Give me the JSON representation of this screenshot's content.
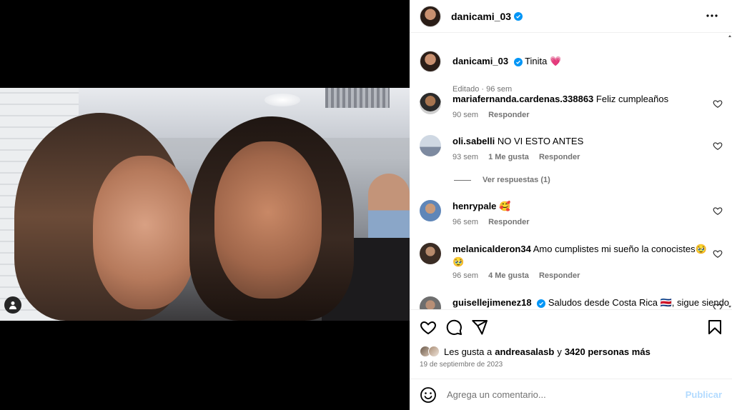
{
  "post": {
    "author": "danicami_03",
    "caption": "Tinita",
    "caption_emoji": "💗",
    "edited_label": "Editado",
    "age": "96 sem"
  },
  "comments": [
    {
      "user": "mariafernanda.cardenas.338863",
      "text": "Feliz cumpleaños",
      "age": "90 sem",
      "likes": "",
      "reply": "Responder"
    },
    {
      "user": "oli.sabelli",
      "text": "NO VI ESTO ANTES",
      "age": "93 sem",
      "likes": "1 Me gusta",
      "reply": "Responder",
      "view_replies": "Ver respuestas (1)"
    },
    {
      "user": "henrypale",
      "text": "🥰",
      "age": "96 sem",
      "likes": "",
      "reply": "Responder"
    },
    {
      "user": "melanicalderon34",
      "text": "Amo cumplistes mi sueño la conocistes🥹",
      "text2": "🥹",
      "age": "96 sem",
      "likes": "4 Me gusta",
      "reply": "Responder"
    },
    {
      "user": "guisellejimenez18",
      "text": "Saludos desde Costa Rica 🇨🇷, sigue siendo"
    }
  ],
  "likes": {
    "prefix": "Les gusta a",
    "user": "andreasalasb",
    "conj": "y",
    "others": "3420 personas más"
  },
  "date": "19 de septiembre de 2023",
  "add_comment": {
    "placeholder": "Agrega un comentario...",
    "publish": "Publicar"
  },
  "icons": [
    "user-tag-icon",
    "verified-icon",
    "more-icon",
    "heart-icon",
    "comment-icon",
    "share-icon",
    "bookmark-icon",
    "emoji-icon"
  ],
  "colors": {
    "verified": "#0095f6",
    "publish_disabled": "#b3dbff",
    "muted": "#737373"
  }
}
